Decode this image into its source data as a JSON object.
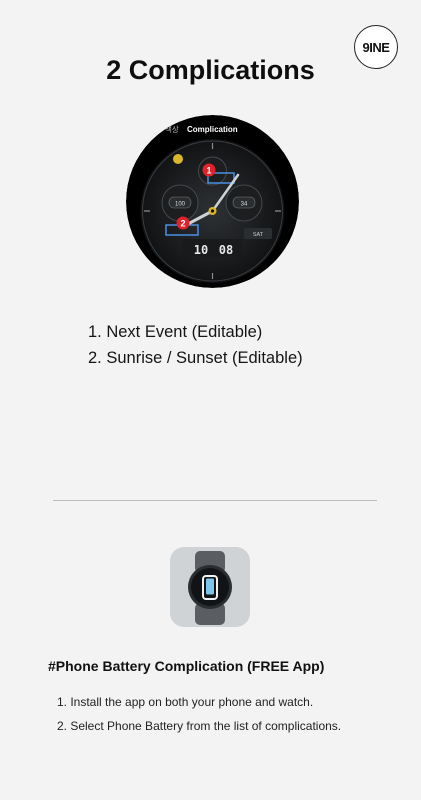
{
  "brand": {
    "logo_text": "9INE"
  },
  "title": "2 Complications",
  "watch_preview": {
    "header_left": "색상",
    "header_title": "Complication",
    "markers": [
      "1",
      "2"
    ],
    "left_dial_value": "100",
    "right_dial_value": "34",
    "date_text": "SAT",
    "time_hours": "10",
    "time_minutes": "08"
  },
  "complications": [
    "1. Next Event (Editable)",
    "2. Sunrise / Sunset (Editable)"
  ],
  "app_section": {
    "heading": "#Phone Battery Complication (FREE App)",
    "steps": [
      "1. Install the app on both your phone and watch.",
      "2. Select Phone Battery from the list of complications."
    ]
  },
  "colors": {
    "background": "#f3f3f3",
    "marker_red": "#e0232a",
    "highlight_blue": "#4a90e2",
    "accent_yellow": "#d9b62c"
  }
}
